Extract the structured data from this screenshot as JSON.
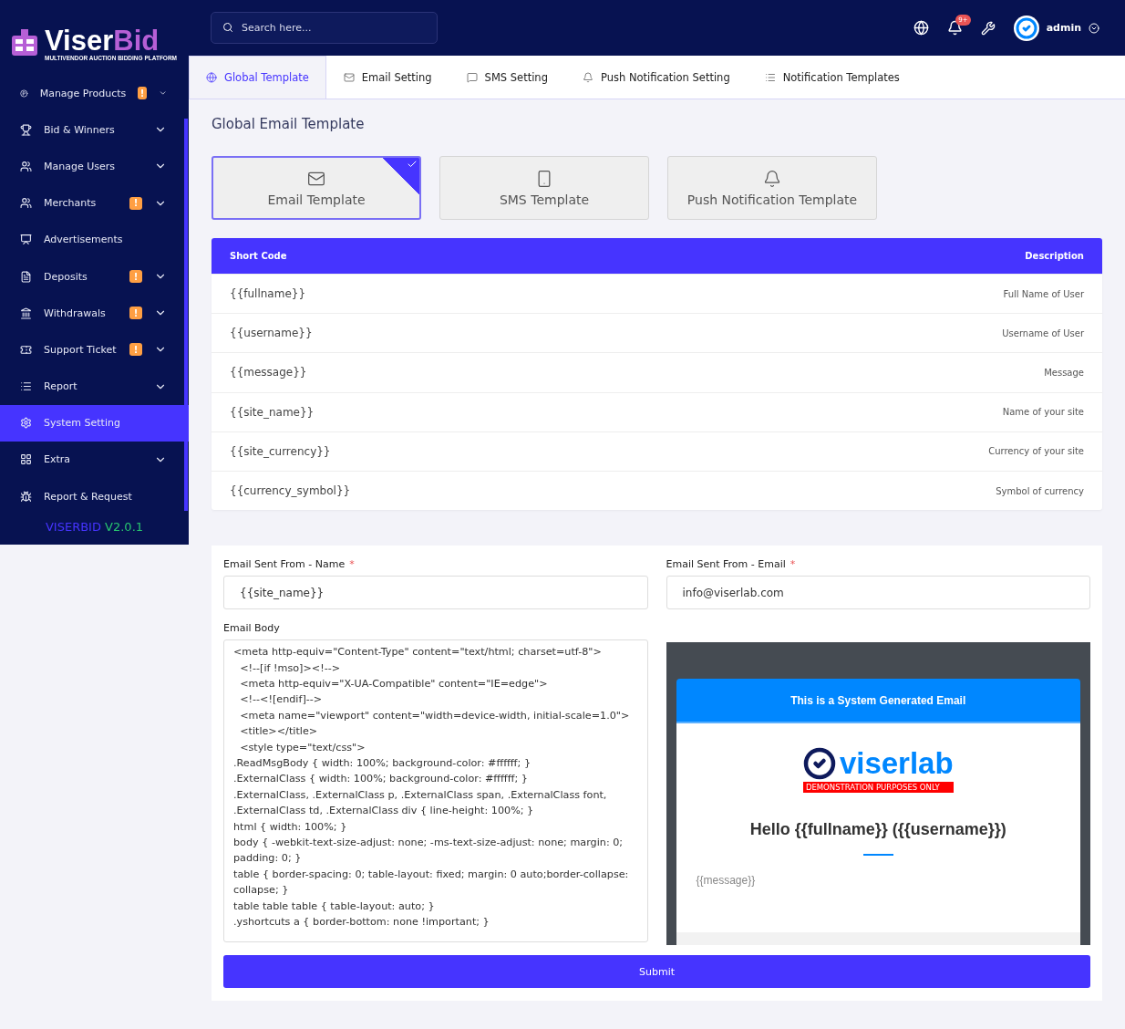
{
  "brand": {
    "name_a": "Viser",
    "name_b": "Bid",
    "tagline": "MULTIVENDOR AUCTION BIDDING PLATFORM"
  },
  "sidebar": {
    "items": [
      {
        "kind": "products",
        "label": "Manage Products",
        "badge": "!",
        "expandable": true,
        "selected": false
      },
      {
        "kind": "trophy",
        "label": "Bid & Winners",
        "expandable": true,
        "selected": false
      },
      {
        "kind": "users",
        "label": "Manage Users",
        "expandable": true,
        "selected": false
      },
      {
        "kind": "users",
        "label": "Merchants",
        "badge": "!",
        "expandable": true,
        "selected": false
      },
      {
        "kind": "ads",
        "label": "Advertisements",
        "expandable": false,
        "selected": false
      },
      {
        "kind": "deposit",
        "label": "Deposits",
        "badge": "!",
        "expandable": true,
        "selected": false
      },
      {
        "kind": "bank",
        "label": "Withdrawals",
        "badge": "!",
        "expandable": true,
        "selected": false
      },
      {
        "kind": "ticket",
        "label": "Support Ticket",
        "badge": "!",
        "expandable": true,
        "selected": false
      },
      {
        "kind": "list",
        "label": "Report",
        "expandable": true,
        "selected": false
      },
      {
        "kind": "gear",
        "label": "System Setting",
        "expandable": false,
        "selected": true
      },
      {
        "kind": "extra",
        "label": "Extra",
        "expandable": true,
        "selected": false
      },
      {
        "kind": "bug",
        "label": "Report & Request",
        "expandable": false,
        "selected": false
      }
    ],
    "version": {
      "name": "VISERBID",
      "number": "V2.0.1"
    }
  },
  "topbar": {
    "search": {
      "placeholder": "Search here..."
    },
    "notification_count": "9+",
    "user": "admin"
  },
  "tabs": [
    {
      "kind": "globe",
      "label": "Global Template",
      "selected": true
    },
    {
      "kind": "mail",
      "label": "Email Setting",
      "selected": false
    },
    {
      "kind": "sms",
      "label": "SMS Setting",
      "selected": false
    },
    {
      "kind": "bell",
      "label": "Push Notification Setting",
      "selected": false
    },
    {
      "kind": "list",
      "label": "Notification Templates",
      "selected": false
    }
  ],
  "title": "Global Email Template",
  "template_cards": [
    {
      "kind": "mail",
      "label": "Email Template",
      "selected": true
    },
    {
      "kind": "phone",
      "label": "SMS Template",
      "selected": false
    },
    {
      "kind": "bell",
      "label": "Push Notification Template",
      "selected": false
    }
  ],
  "shortcodes": {
    "columns": [
      "Short Code",
      "Description"
    ],
    "rows": [
      {
        "code": "{{fullname}}",
        "description": "Full Name of User"
      },
      {
        "code": "{{username}}",
        "description": "Username of User"
      },
      {
        "code": "{{message}}",
        "description": "Message"
      },
      {
        "code": "{{site_name}}",
        "description": "Name of your site"
      },
      {
        "code": "{{site_currency}}",
        "description": "Currency of your site"
      },
      {
        "code": "{{currency_symbol}}",
        "description": "Symbol of currency"
      }
    ]
  },
  "form": {
    "fields": [
      {
        "label": "Email Sent From - Name",
        "required_mark": "*",
        "value": "{{site_name}}"
      },
      {
        "label": "Email Sent From - Email",
        "required_mark": "*",
        "value": "info@viserlab.com"
      }
    ],
    "body_label": "Email Body",
    "body_lines": [
      "<meta http-equiv=\"Content-Type\" content=\"text/html; charset=utf-8\">",
      "  <!--[if !mso]><!-->",
      "  <meta http-equiv=\"X-UA-Compatible\" content=\"IE=edge\">",
      "  <!--<![endif]-->",
      "  <meta name=\"viewport\" content=\"width=device-width, initial-scale=1.0\">",
      "  <title></title>",
      "  <style type=\"text/css\">",
      ".ReadMsgBody { width: 100%; background-color: #ffffff; }",
      ".ExternalClass { width: 100%; background-color: #ffffff; }",
      ".ExternalClass, .ExternalClass p, .ExternalClass span, .ExternalClass font,",
      ".ExternalClass td, .ExternalClass div { line-height: 100%; }",
      "html { width: 100%; }",
      "body { -webkit-text-size-adjust: none; -ms-text-size-adjust: none; margin: 0; padding: 0; }",
      "table { border-spacing: 0; table-layout: fixed; margin: 0 auto;border-collapse: collapse; }",
      "table table table { table-layout: auto; }",
      ".yshortcuts a { border-bottom: none !important; }"
    ],
    "preview": {
      "header": "This is a System Generated Email",
      "logo": "viserlab",
      "logo_tag": "DEMONSTRATION PURPOSES ONLY",
      "greeting": "Hello {{fullname}} ({{username}})",
      "message": "{{message}}"
    },
    "submit": "Submit"
  }
}
